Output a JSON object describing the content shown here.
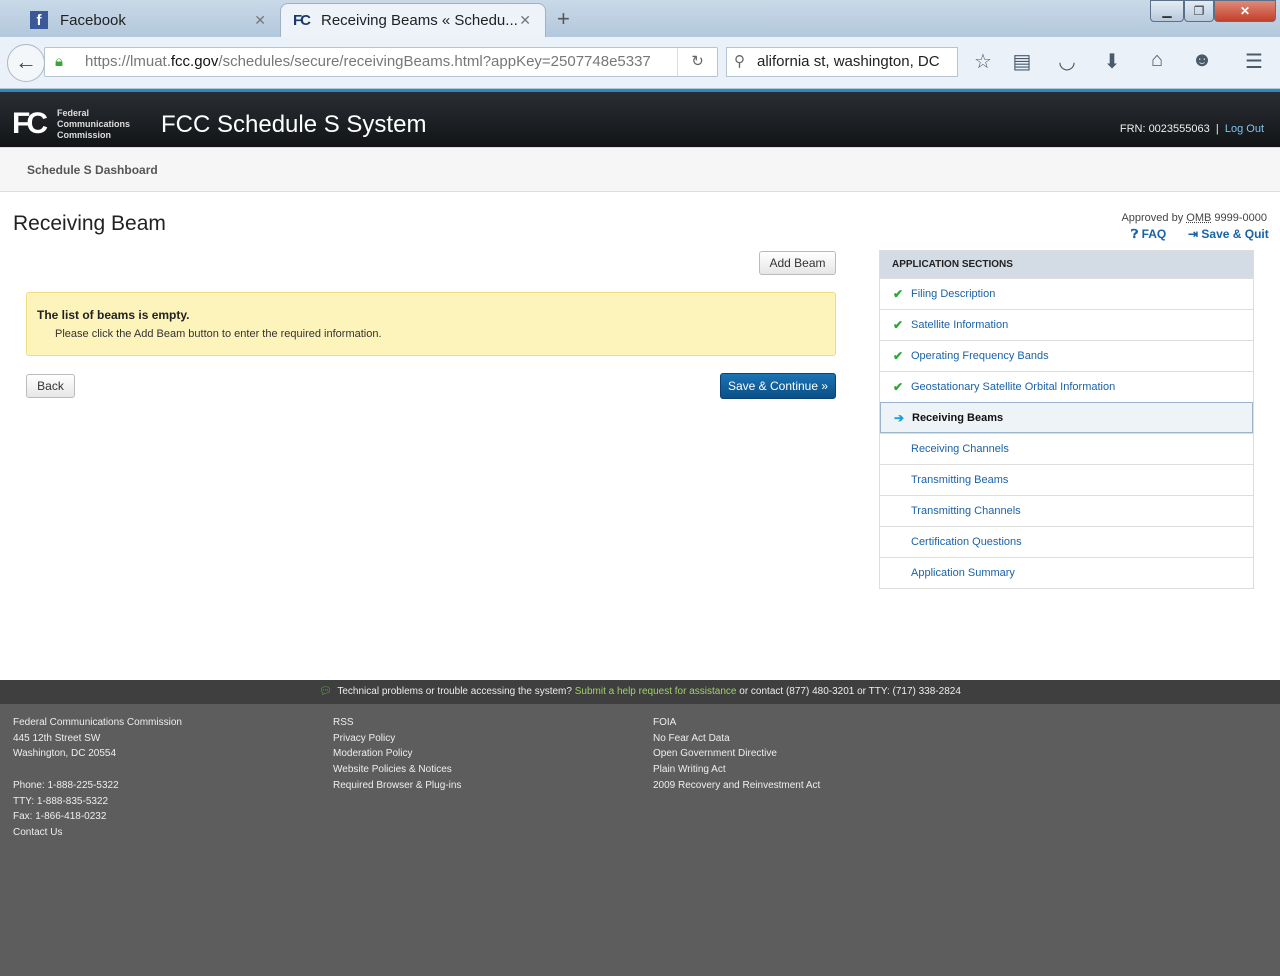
{
  "browser": {
    "tabs": [
      {
        "label": "Facebook",
        "icon": "facebook-icon"
      },
      {
        "label": "Receiving Beams « Schedu...",
        "icon": "fcc-icon",
        "active": true
      }
    ],
    "url_prefix": "https://lmuat.",
    "url_domain": "fcc.gov",
    "url_path": "/schedules/secure/receivingBeams.html?appKey=2507748e5337",
    "search_value": "alifornia st, washington, DC"
  },
  "header": {
    "logo_text": "FC",
    "logo_lines": [
      "Federal",
      "Communications",
      "Commission"
    ],
    "title": "FCC Schedule S System",
    "frn": "FRN: 0023555063",
    "separator": "|",
    "logout": "Log Out"
  },
  "subnav": {
    "dashboard": "Schedule S Dashboard"
  },
  "page": {
    "title": "Receiving Beam",
    "approved_prefix": "Approved by",
    "omb": "OMB",
    "omb_number": "9999-0000",
    "faq": "FAQ",
    "save_quit": "Save & Quit",
    "add_beam": "Add Beam",
    "alert_title": "The list of beams is empty.",
    "alert_message": "Please click the Add Beam button to enter the required information.",
    "back": "Back",
    "save_continue": "Save & Continue »"
  },
  "sections": {
    "heading": "APPLICATION SECTIONS",
    "items": [
      {
        "label": "Filing Description",
        "status": "complete"
      },
      {
        "label": "Satellite Information",
        "status": "complete"
      },
      {
        "label": "Operating Frequency Bands",
        "status": "complete"
      },
      {
        "label": "Geostationary Satellite Orbital Information",
        "status": "complete"
      },
      {
        "label": "Receiving Beams",
        "status": "current"
      },
      {
        "label": "Receiving Channels",
        "status": "pending"
      },
      {
        "label": "Transmitting Beams",
        "status": "pending"
      },
      {
        "label": "Transmitting Channels",
        "status": "pending"
      },
      {
        "label": "Certification Questions",
        "status": "pending"
      },
      {
        "label": "Application Summary",
        "status": "pending"
      }
    ]
  },
  "helpbar": {
    "text": "Technical problems or trouble accessing the system?",
    "link": "Submit a help request for assistance",
    "contact": "or contact (877) 480-3201 or TTY: (717) 338-2824"
  },
  "footer": {
    "col1": [
      "Federal Communications Commission",
      "445 12th Street SW",
      "Washington, DC 20554",
      "",
      "Phone: 1-888-225-5322",
      "TTY: 1-888-835-5322",
      "Fax: 1-866-418-0232",
      "Contact Us"
    ],
    "col2": [
      "RSS",
      "Privacy Policy",
      "Moderation Policy",
      "Website Policies & Notices",
      "Required Browser & Plug-ins"
    ],
    "col3": [
      "FOIA",
      "No Fear Act Data",
      "Open Government Directive",
      "Plain Writing Act",
      "2009 Recovery and Reinvestment Act"
    ]
  }
}
